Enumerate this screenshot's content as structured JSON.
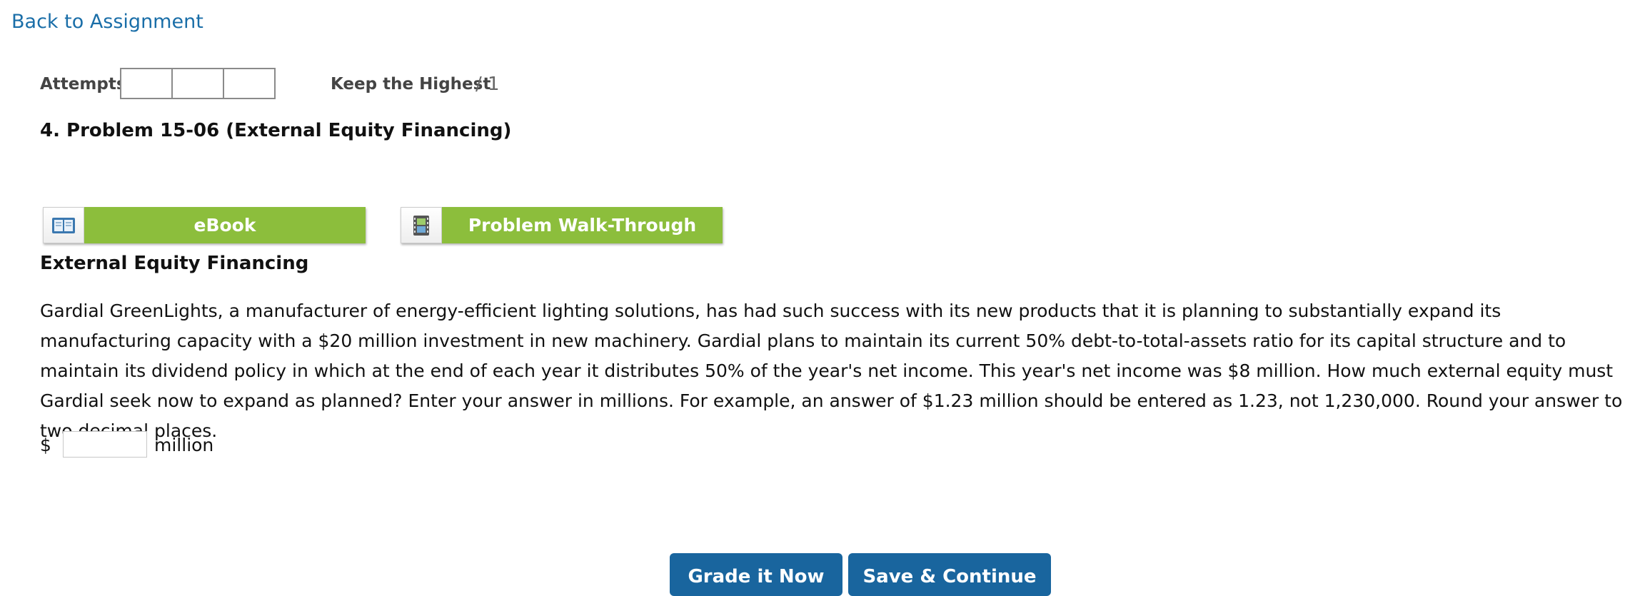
{
  "nav": {
    "back_label": "Back to Assignment"
  },
  "attempts": {
    "label": "Attempts",
    "boxes": [
      "",
      "",
      ""
    ],
    "policy": "Keep the Highest",
    "score": "/ 1"
  },
  "problem": {
    "title": "4.  Problem 15-06 (External Equity Financing)",
    "section_heading": "External Equity Financing",
    "text": "Gardial GreenLights, a manufacturer of energy-efficient lighting solutions, has had such success with its new products that it is planning to substantially expand its manufacturing capacity with a $20 million investment in new machinery. Gardial plans to maintain its current 50% debt-to-total-assets ratio for its capital structure and to maintain its dividend policy in which at the end of each year it distributes 50% of the year's net income. This year's net income was $8 million. How much external equity must Gardial seek now to expand as planned? Enter your answer in millions. For example, an answer of $1.23 million should be entered as 1.23, not 1,230,000. Round your answer to two decimal places."
  },
  "resources": {
    "ebook_label": "eBook",
    "ebook_icon": "book-icon",
    "walkthrough_label": "Problem Walk-Through",
    "walkthrough_icon": "film-icon"
  },
  "answer": {
    "currency": "$",
    "value": "",
    "unit": "million"
  },
  "actions": {
    "grade_label": "Grade it Now",
    "save_label": "Save & Continue"
  },
  "colors": {
    "link": "#1a6ea8",
    "resource_green": "#8cbe3c",
    "action_blue": "#19659e"
  }
}
